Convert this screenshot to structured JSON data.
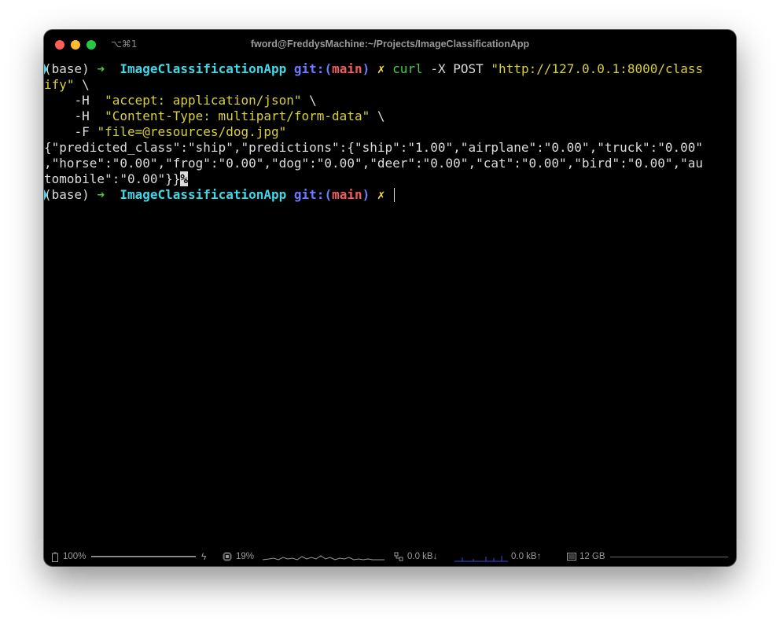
{
  "window": {
    "shortcut": "⌥⌘1",
    "title": "fword@FreddysMachine:~/Projects/ImageClassificationApp"
  },
  "prompt": {
    "env": "(base)",
    "arrow": "➜",
    "dir": "ImageClassificationApp",
    "git_label": "git:(",
    "branch": "main",
    "git_close": ")",
    "dirty": "✗"
  },
  "command": {
    "program": "curl",
    "args": "-X POST",
    "url_part1": "\"http://127.0.0.1:8000/class",
    "url_part2": "ify\"",
    "cont": "\\",
    "indent": "    ",
    "header_flag": "-H",
    "accept": "\"accept: application/json\"",
    "content_type": "\"Content-Type: multipart/form-data\"",
    "file_flag": "-F",
    "file": "\"file=@resources/dog.jpg\""
  },
  "output": {
    "line1": "{\"predicted_class\":\"ship\",\"predictions\":{\"ship\":\"1.00\",\"airplane\":\"0.00\",\"truck\":\"0.00\"",
    "line2": ",\"horse\":\"0.00\",\"frog\":\"0.00\",\"dog\":\"0.00\",\"deer\":\"0.00\",\"cat\":\"0.00\",\"bird\":\"0.00\",\"au",
    "line3": "tomobile\":\"0.00\"}}",
    "eol_marker": "%"
  },
  "statusbar": {
    "battery": "100%",
    "cpu": "19%",
    "net_down": "0.0 kB↓",
    "net_up": "0.0 kB↑",
    "memory": "12 GB",
    "battery_level": 1.0,
    "cpu_level": 0.19
  }
}
